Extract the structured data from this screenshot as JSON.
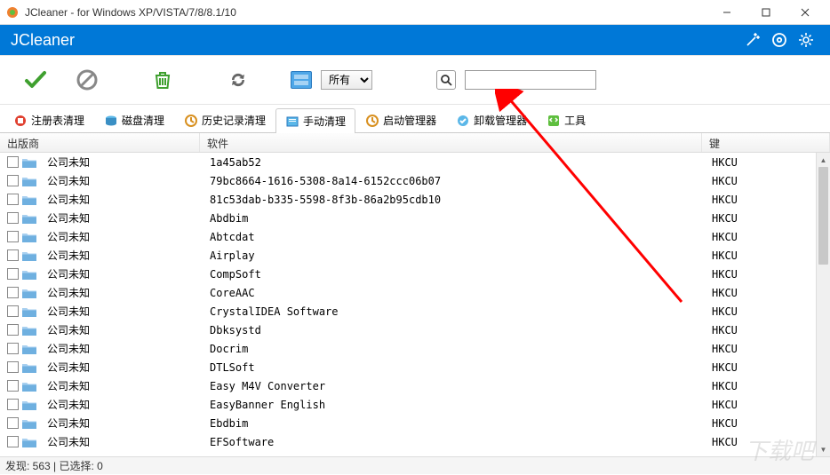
{
  "window": {
    "title": "JCleaner - for Windows XP/VISTA/7/8/8.1/10"
  },
  "brand": "JCleaner",
  "filter": {
    "selected": "所有"
  },
  "search": {
    "value": ""
  },
  "tabs": [
    {
      "label": "注册表清理",
      "icon": "registry"
    },
    {
      "label": "磁盘清理",
      "icon": "disk"
    },
    {
      "label": "历史记录清理",
      "icon": "history"
    },
    {
      "label": "手动清理",
      "icon": "manual",
      "active": true
    },
    {
      "label": "启动管理器",
      "icon": "startup"
    },
    {
      "label": "卸载管理器",
      "icon": "uninstall"
    },
    {
      "label": "工具",
      "icon": "tools"
    }
  ],
  "columns": {
    "publisher": "出版商",
    "software": "软件",
    "key": "键"
  },
  "rows": [
    {
      "publisher": "公司未知",
      "software": "1a45ab52",
      "key": "HKCU"
    },
    {
      "publisher": "公司未知",
      "software": "79bc8664-1616-5308-8a14-6152ccc06b07",
      "key": "HKCU"
    },
    {
      "publisher": "公司未知",
      "software": "81c53dab-b335-5598-8f3b-86a2b95cdb10",
      "key": "HKCU"
    },
    {
      "publisher": "公司未知",
      "software": "Abdbim",
      "key": "HKCU"
    },
    {
      "publisher": "公司未知",
      "software": "Abtcdat",
      "key": "HKCU"
    },
    {
      "publisher": "公司未知",
      "software": "Airplay",
      "key": "HKCU"
    },
    {
      "publisher": "公司未知",
      "software": "CompSoft",
      "key": "HKCU"
    },
    {
      "publisher": "公司未知",
      "software": "CoreAAC",
      "key": "HKCU"
    },
    {
      "publisher": "公司未知",
      "software": "CrystalIDEA Software",
      "key": "HKCU"
    },
    {
      "publisher": "公司未知",
      "software": "Dbksystd",
      "key": "HKCU"
    },
    {
      "publisher": "公司未知",
      "software": "Docrim",
      "key": "HKCU"
    },
    {
      "publisher": "公司未知",
      "software": "DTLSoft",
      "key": "HKCU"
    },
    {
      "publisher": "公司未知",
      "software": "Easy M4V Converter",
      "key": "HKCU"
    },
    {
      "publisher": "公司未知",
      "software": "EasyBanner English",
      "key": "HKCU"
    },
    {
      "publisher": "公司未知",
      "software": "Ebdbim",
      "key": "HKCU"
    },
    {
      "publisher": "公司未知",
      "software": "EFSoftware",
      "key": "HKCU"
    }
  ],
  "status": "发现: 563  |  已选择: 0",
  "watermark": "下载吧"
}
